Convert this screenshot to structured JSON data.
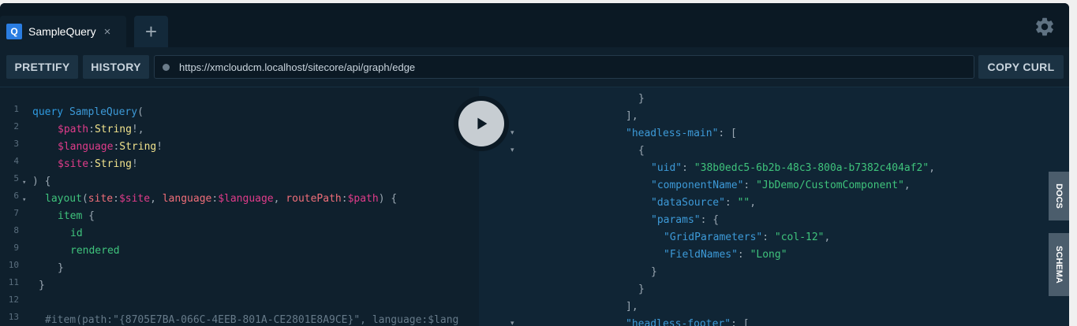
{
  "tab": {
    "icon_letter": "Q",
    "title": "SampleQuery",
    "close": "×"
  },
  "add_tab": "+",
  "toolbar": {
    "prettify": "PRETTIFY",
    "history": "HISTORY",
    "url": "https://xmcloudcm.localhost/sitecore/api/graph/edge",
    "copy_curl": "COPY CURL"
  },
  "editor": {
    "line_numbers": [
      "1",
      "2",
      "3",
      "4",
      "5",
      "6",
      "7",
      "8",
      "9",
      "10",
      "11",
      "12",
      "13"
    ],
    "fold_markers": [
      "▾",
      "▾"
    ],
    "lines": {
      "l1": [
        "query",
        " ",
        "SampleQuery",
        "("
      ],
      "l2": [
        "$path",
        ":",
        "String",
        "!,"
      ],
      "l3": [
        "$language",
        ":",
        "String",
        "!"
      ],
      "l4": [
        "$site",
        ":",
        "String",
        "!"
      ],
      "l5": [
        ") {"
      ],
      "l6": [
        "layout",
        "(",
        "site",
        ":",
        "$site",
        ", ",
        "language",
        ":",
        "$language",
        ", ",
        "routePath",
        ":",
        "$path",
        ") {"
      ],
      "l7": [
        "item",
        " {"
      ],
      "l8": [
        "id"
      ],
      "l9": [
        "rendered"
      ],
      "l10": [
        "}"
      ],
      "l11": [
        "}"
      ],
      "l12": [
        ""
      ],
      "l13": [
        "#item(path:\"{8705E7BA-066C-4EEB-801A-CE2801E8A9CE}\", language:$lang"
      ]
    }
  },
  "results": {
    "fold_markers": [
      "▾",
      "▾",
      "▾"
    ],
    "lines": {
      "r0": [
        "}"
      ],
      "r1": [
        "}"
      ],
      "r2": [
        "],"
      ],
      "r3": [
        "\"headless-main\"",
        ": ["
      ],
      "r4": [
        "{"
      ],
      "r5": [
        "\"uid\"",
        ": ",
        "\"38b0edc5-6b2b-48c3-800a-b7382c404af2\"",
        ","
      ],
      "r6": [
        "\"componentName\"",
        ": ",
        "\"JbDemo/CustomComponent\"",
        ","
      ],
      "r7": [
        "\"dataSource\"",
        ": ",
        "\"\"",
        ","
      ],
      "r8": [
        "\"params\"",
        ": {"
      ],
      "r9": [
        "\"GridParameters\"",
        ": ",
        "\"col-12\"",
        ","
      ],
      "r10": [
        "\"FieldNames\"",
        ": ",
        "\"Long\""
      ],
      "r11": [
        "}"
      ],
      "r12": [
        "}"
      ],
      "r13": [
        "],"
      ],
      "r14": [
        "\"headless-footer\"",
        ": ["
      ]
    }
  },
  "side_tabs": {
    "docs": "DOCS",
    "schema": "SCHEMA"
  },
  "colors": {
    "background": "#0f202d",
    "accent": "#2a7de1",
    "string": "#3fc37c",
    "key": "#3d9ad8",
    "variable": "#e03c8a",
    "type": "#f0e28c"
  }
}
